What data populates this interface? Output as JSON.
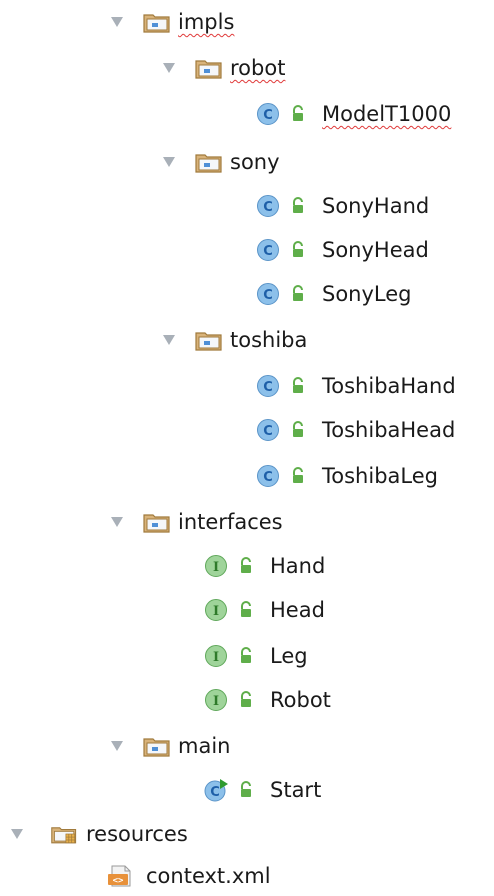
{
  "tree": {
    "nodes": [
      {
        "id": "impls",
        "label": "impls",
        "kind": "package",
        "expanded": true,
        "misspelled": true
      },
      {
        "id": "robot",
        "label": "robot",
        "kind": "package",
        "expanded": true,
        "misspelled": true
      },
      {
        "id": "modelt1000",
        "label": "ModelT1000",
        "kind": "class",
        "visibility": "public",
        "misspelled": true
      },
      {
        "id": "sony",
        "label": "sony",
        "kind": "package",
        "expanded": true
      },
      {
        "id": "sonyhand",
        "label": "SonyHand",
        "kind": "class",
        "visibility": "public"
      },
      {
        "id": "sonyhead",
        "label": "SonyHead",
        "kind": "class",
        "visibility": "public"
      },
      {
        "id": "sonyleg",
        "label": "SonyLeg",
        "kind": "class",
        "visibility": "public"
      },
      {
        "id": "toshiba",
        "label": "toshiba",
        "kind": "package",
        "expanded": true
      },
      {
        "id": "toshibahand",
        "label": "ToshibaHand",
        "kind": "class",
        "visibility": "public"
      },
      {
        "id": "toshibahead",
        "label": "ToshibaHead",
        "kind": "class",
        "visibility": "public"
      },
      {
        "id": "toshibaleg",
        "label": "ToshibaLeg",
        "kind": "class",
        "visibility": "public"
      },
      {
        "id": "interfaces",
        "label": "interfaces",
        "kind": "package",
        "expanded": true
      },
      {
        "id": "hand",
        "label": "Hand",
        "kind": "interface",
        "visibility": "public"
      },
      {
        "id": "head",
        "label": "Head",
        "kind": "interface",
        "visibility": "public"
      },
      {
        "id": "leg",
        "label": "Leg",
        "kind": "interface",
        "visibility": "public"
      },
      {
        "id": "robot-iface",
        "label": "Robot",
        "kind": "interface",
        "visibility": "public"
      },
      {
        "id": "main",
        "label": "main",
        "kind": "package",
        "expanded": true
      },
      {
        "id": "start",
        "label": "Start",
        "kind": "runnable-class",
        "visibility": "public"
      },
      {
        "id": "resources",
        "label": "resources",
        "kind": "resources-folder",
        "expanded": true
      },
      {
        "id": "context-xml",
        "label": "context.xml",
        "kind": "xml-file"
      }
    ]
  },
  "colors": {
    "arrow": "#a9b0b8",
    "folder_fill": "#d9b37a",
    "folder_edge": "#a07a3c",
    "folder_tag": "#4f8fd6",
    "class_fill": "#8cc0ea",
    "class_text": "#1e5fa8",
    "interface_fill": "#9fd49a",
    "interface_text": "#2e7a2a",
    "lock": "#5fae4a",
    "run_arrow": "#2f9a2f",
    "misspell": "#e03a3a"
  }
}
